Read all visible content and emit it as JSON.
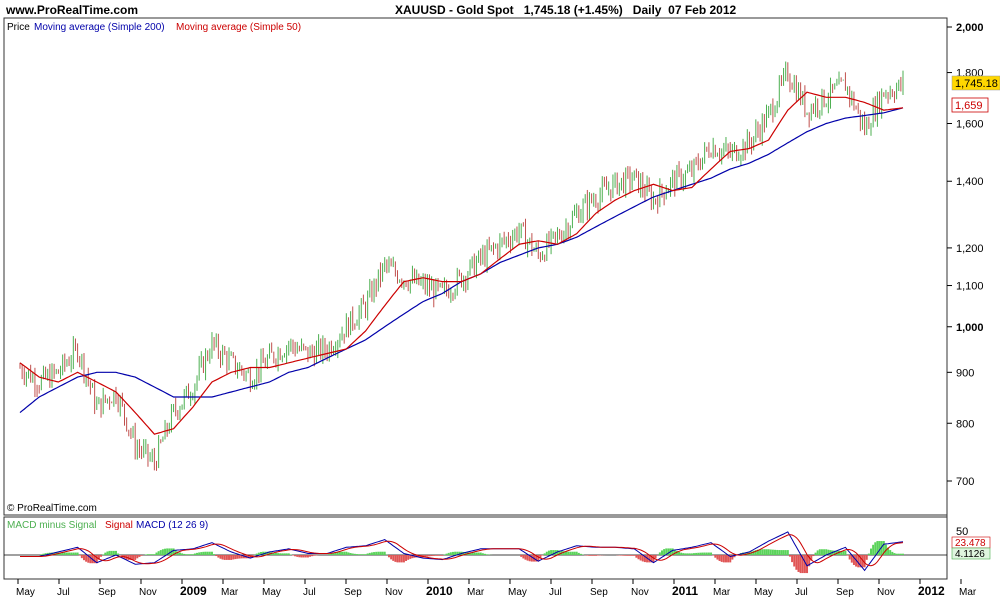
{
  "header": {
    "site": "www.ProRealTime.com",
    "instrument": "XAUUSD - Gold Spot",
    "last_price": "1,745.18",
    "change": "(+1.45%)",
    "period": "Daily",
    "date": "07 Feb 2012"
  },
  "legend": {
    "price": "Price",
    "ma200": "Moving average (Simple 200)",
    "ma50": "Moving average (Simple 50)"
  },
  "macd_legend": {
    "hist": "MACD minus Signal",
    "signal": "Signal",
    "macd": "MACD (12 26 9)"
  },
  "watermark": "© ProRealTime.com",
  "colors": {
    "price_up": "#4caf50",
    "price_down": "#c0504d",
    "ma50": "#cc0000",
    "ma200": "#0000aa",
    "last_price_bg": "#ffd700",
    "macd_line": "#0000aa",
    "signal_line": "#cc0000",
    "hist_pos": "#5bd35b",
    "hist_neg": "#e05555"
  },
  "price_axis": {
    "ticks": [
      "2,000",
      "1,800",
      "1,600",
      "1,400",
      "1,200",
      "1,100",
      "1,000",
      "900",
      "800",
      "700"
    ],
    "last_label": "1,745.18",
    "ma50_label": "1,659"
  },
  "macd_axis": {
    "tick": "50",
    "signal_label": "23.478",
    "hist_label": "4.1126"
  },
  "x_axis": {
    "labels": [
      "May",
      "Jul",
      "Sep",
      "Nov",
      "2009",
      "Mar",
      "May",
      "Jul",
      "Sep",
      "Nov",
      "2010",
      "Mar",
      "May",
      "Jul",
      "Sep",
      "Nov",
      "2011",
      "Mar",
      "May",
      "Jul",
      "Sep",
      "Nov",
      "2012",
      "Mar"
    ],
    "year_labels": [
      "2009",
      "2010",
      "2011",
      "2012"
    ]
  },
  "chart_data": {
    "type": "line",
    "scale": "log",
    "ylim": [
      660,
      2050
    ],
    "x": [
      "2008-04",
      "2008-05",
      "2008-06",
      "2008-07",
      "2008-08",
      "2008-09",
      "2008-10",
      "2008-11",
      "2008-12",
      "2009-01",
      "2009-02",
      "2009-03",
      "2009-04",
      "2009-05",
      "2009-06",
      "2009-07",
      "2009-08",
      "2009-09",
      "2009-10",
      "2009-11",
      "2009-12",
      "2010-01",
      "2010-02",
      "2010-03",
      "2010-04",
      "2010-05",
      "2010-06",
      "2010-07",
      "2010-08",
      "2010-09",
      "2010-10",
      "2010-11",
      "2010-12",
      "2011-01",
      "2011-02",
      "2011-03",
      "2011-04",
      "2011-05",
      "2011-06",
      "2011-07",
      "2011-08",
      "2011-09",
      "2011-10",
      "2011-11",
      "2011-12",
      "2012-01",
      "2012-02"
    ],
    "series": [
      {
        "name": "Price",
        "values": [
          910,
          880,
          900,
          950,
          830,
          860,
          760,
          730,
          820,
          870,
          960,
          920,
          890,
          930,
          960,
          940,
          950,
          1000,
          1050,
          1150,
          1120,
          1100,
          1080,
          1120,
          1170,
          1210,
          1250,
          1180,
          1230,
          1300,
          1350,
          1390,
          1410,
          1340,
          1400,
          1430,
          1520,
          1490,
          1530,
          1630,
          1800,
          1650,
          1700,
          1750,
          1580,
          1720,
          1745
        ]
      },
      {
        "name": "Moving average (Simple 50)",
        "values": [
          920,
          890,
          880,
          900,
          880,
          860,
          820,
          780,
          790,
          830,
          880,
          900,
          910,
          910,
          920,
          930,
          940,
          950,
          990,
          1050,
          1110,
          1120,
          1110,
          1110,
          1130,
          1170,
          1210,
          1220,
          1210,
          1240,
          1300,
          1340,
          1370,
          1390,
          1370,
          1380,
          1440,
          1500,
          1510,
          1540,
          1650,
          1720,
          1700,
          1700,
          1680,
          1650,
          1659
        ]
      },
      {
        "name": "Moving average (Simple 200)",
        "values": [
          820,
          850,
          870,
          890,
          900,
          900,
          890,
          870,
          850,
          850,
          850,
          860,
          870,
          880,
          900,
          910,
          930,
          950,
          970,
          1000,
          1030,
          1060,
          1080,
          1110,
          1130,
          1160,
          1180,
          1200,
          1210,
          1230,
          1260,
          1290,
          1320,
          1350,
          1370,
          1390,
          1410,
          1440,
          1460,
          1490,
          1530,
          1570,
          1600,
          1620,
          1630,
          1640,
          1659
        ]
      }
    ]
  }
}
